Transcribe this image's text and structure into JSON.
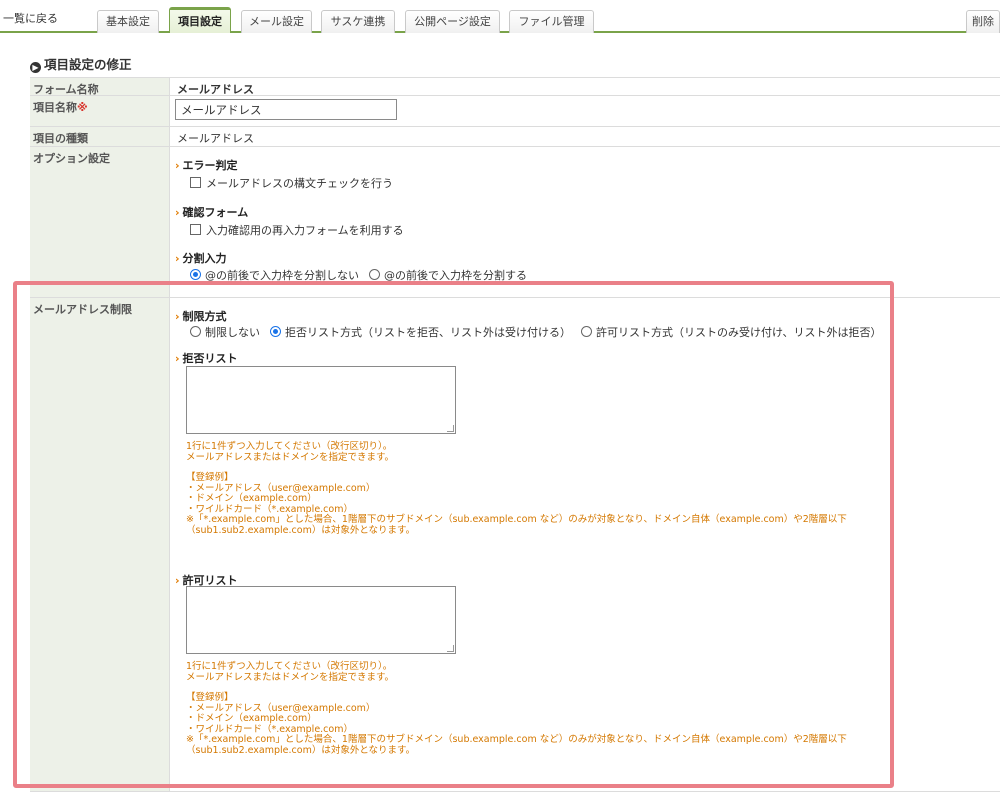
{
  "nav": {
    "back": "一覧に戻る",
    "tabs": [
      "基本設定",
      "項目設定",
      "メール設定",
      "サスケ連携",
      "公開ページ設定",
      "ファイル管理"
    ],
    "delete": "削除"
  },
  "section_title": "項目設定の修正",
  "form": {
    "form_name_label": "フォーム名称",
    "form_name_value": "メールアドレス",
    "item_name_label": "項目名称",
    "required_mark": "※",
    "item_name_value": "メールアドレス",
    "item_type_label": "項目の種類",
    "item_type_value": "メールアドレス",
    "option_label": "オプション設定",
    "error_check_head": "エラー判定",
    "error_check_option": "メールアドレスの構文チェックを行う",
    "confirm_head": "確認フォーム",
    "confirm_option": "入力確認用の再入力フォームを利用する",
    "split_head": "分割入力",
    "split_options": [
      "@の前後で入力枠を分割しない",
      "@の前後で入力枠を分割する"
    ],
    "restriction_label": "メールアドレス制限",
    "method_head": "制限方式",
    "method_options": [
      "制限しない",
      "拒否リスト方式（リストを拒否、リスト外は受け付ける）",
      "許可リスト方式（リストのみ受け付け、リスト外は拒否）"
    ],
    "deny_head": "拒否リスト",
    "allow_head": "許可リスト",
    "help": {
      "line1": "1行に1件ずつ入力してください（改行区切り）。",
      "line2": "メールアドレスまたはドメインを指定できます。",
      "example_head": "【登録例】",
      "ex1": "・メールアドレス（user@example.com）",
      "ex2": "・ドメイン（example.com）",
      "ex3": "・ワイルドカード（*.example.com）",
      "note1": "※「*.example.com」とした場合、1階層下のサブドメイン（sub.example.com など）のみが対象となり、ドメイン自体（example.com）や2階層以下",
      "note2": "（sub1.sub2.example.com）は対象外となります。"
    }
  },
  "colors": {
    "accent": "#7aa34a",
    "highlight": "#ea8088",
    "note": "#d47800",
    "radio": "#1a73e8"
  }
}
